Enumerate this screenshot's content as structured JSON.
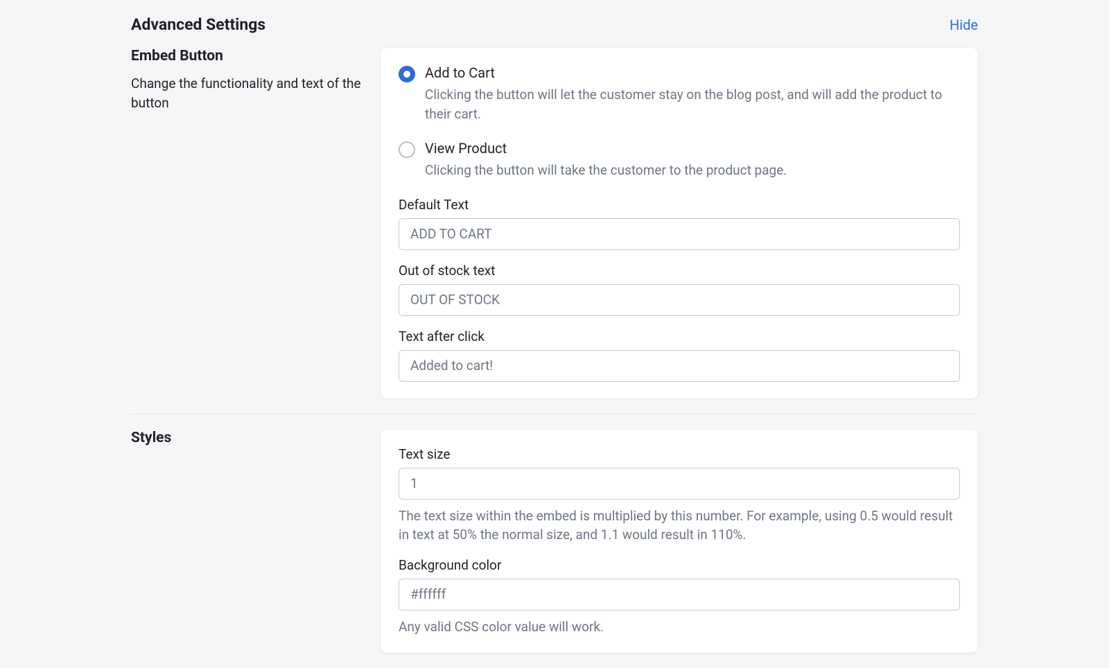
{
  "header": {
    "title": "Advanced Settings",
    "hide": "Hide"
  },
  "embed": {
    "title": "Embed Button",
    "desc": "Change the functionality and text of the button",
    "options": [
      {
        "label": "Add to Cart",
        "desc": "Clicking the button will let the customer stay on the blog post, and will add the product to their cart."
      },
      {
        "label": "View Product",
        "desc": "Clicking the button will take the customer to the product page."
      }
    ],
    "fields": {
      "default_text": {
        "label": "Default Text",
        "value": "ADD TO CART"
      },
      "out_of_stock": {
        "label": "Out of stock text",
        "value": "OUT OF STOCK"
      },
      "after_click": {
        "label": "Text after click",
        "value": "Added to cart!"
      }
    }
  },
  "styles": {
    "title": "Styles",
    "text_size": {
      "label": "Text size",
      "value": "1",
      "help": "The text size within the embed is multiplied by this number. For example, using 0.5 would result in text at 50% the normal size, and 1.1 would result in 110%."
    },
    "bg_color": {
      "label": "Background color",
      "value": "#ffffff",
      "help": "Any valid CSS color value will work."
    }
  }
}
